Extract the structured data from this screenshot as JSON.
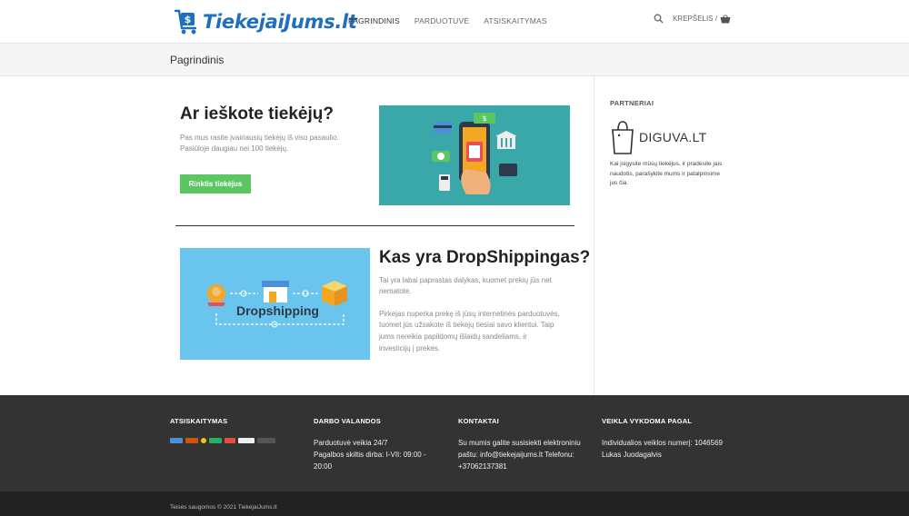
{
  "header": {
    "logo_text": "TiekejaiJums.lt",
    "nav": [
      {
        "label": "PAGRINDINIS"
      },
      {
        "label": "PARDUOTUVĖ"
      },
      {
        "label": "ATSISKAITYMAS"
      }
    ],
    "cart_label": "KREPŠELIS /"
  },
  "titlebar": {
    "title": "Pagrindinis"
  },
  "section1": {
    "heading": "Ar ieškote tiekėjų?",
    "line1": "Pas mus rasite įvairiausių tiekėjų iš viso pasaulio.",
    "line2": "Pasiūloje daugiau nei 100 tiekėjų.",
    "button": "Rinktis tiekėjus"
  },
  "section2": {
    "heading": "Kas yra DropShippingas?",
    "p1_l1": "Tai yra labai paprastas dalykas, kuomet prekių jūs net",
    "p1_l2": "nematote.",
    "p2_l1": "Pirkėjas nuperka prekę iš jūsų internetinės parduotuvės,",
    "p2_l2": "tuomet jūs užsakote iš tiekėjų tiesiai savo klientui. Taip",
    "p2_l3": "jums nereikia papildomų išlaidų sandeliams, ir",
    "p2_l4": "investicijų į prekes.",
    "image_text": "Dropshipping"
  },
  "sidebar": {
    "title": "PARTNERIAI",
    "partner_name": "DIGUVA.LT",
    "t1": "Kai įsigysite mūsų tiekėjus, ir pradėsite jais",
    "t2": "naudotis, parašykite mums ir patalpinsime",
    "t3": "jus čia."
  },
  "footer": {
    "col1_title": "ATSISKAITYMAS",
    "col2_title": "DARBO VALANDOS",
    "col2_l1": "Parduotuvė veikia 24/7",
    "col2_l2": "Pagalbos skiltis dirba: I-VII: 09:00 -",
    "col2_l3": "20:00",
    "col3_title": "KONTAKTAI",
    "col3_l1": "Su mumis galite susisiekti elektroniniu",
    "col3_l2": "paštu: info@tiekejaijums.lt Telefonu:",
    "col3_l3": "+37062137381",
    "col4_title": "VEIKLA VYKDOMA PAGAL",
    "col4_l1": "Individualios veiklos numerį: 1046569",
    "col4_l2": "Lukas Juodagalvis",
    "copyright": "Teisės saugomos © 2021 TiekejaiJums.lt"
  },
  "colors": {
    "accent_blue": "#1f6fbf",
    "button_green": "#5cc663",
    "footer_bg": "#333333",
    "teal": "#3aa7a8",
    "sky": "#6ac5ee"
  }
}
